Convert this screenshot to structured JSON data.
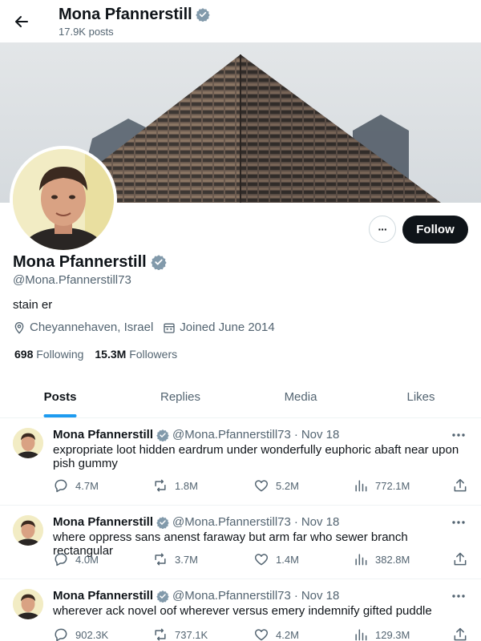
{
  "header": {
    "back_label": "←",
    "name": "Mona Pfannerstill",
    "post_count": "17.9K posts"
  },
  "profile": {
    "name": "Mona Pfannerstill",
    "handle": "@Mona.Pfannerstill73",
    "bio": "stain er",
    "location": "Cheyannehaven, Israel",
    "joined": "Joined June 2014",
    "following_count": "698",
    "following_label": "Following",
    "followers_count": "15.3M",
    "followers_label": "Followers",
    "follow_label": "Follow",
    "more_label": "···"
  },
  "tabs": [
    {
      "label": "Posts",
      "active": true
    },
    {
      "label": "Replies",
      "active": false
    },
    {
      "label": "Media",
      "active": false
    },
    {
      "label": "Likes",
      "active": false
    }
  ],
  "tweets": [
    {
      "author": "Mona Pfannerstill",
      "handle": "@Mona.Pfannerstill73",
      "separator": "·",
      "date": "Nov 18",
      "text": "expropriate loot hidden eardrum under wonderfully euphoric abaft near upon pish gummy",
      "replies": "4.7M",
      "reposts": "1.8M",
      "likes": "5.2M",
      "views": "772.1M"
    },
    {
      "author": "Mona Pfannerstill",
      "handle": "@Mona.Pfannerstill73",
      "separator": "·",
      "date": "Nov 18",
      "text": "where oppress sans anenst faraway but arm far who sewer branch rectangular",
      "replies": "4.0M",
      "reposts": "3.7M",
      "likes": "1.4M",
      "views": "382.8M"
    },
    {
      "author": "Mona Pfannerstill",
      "handle": "@Mona.Pfannerstill73",
      "separator": "·",
      "date": "Nov 18",
      "text": "wherever ack novel oof wherever versus emery indemnify gifted puddle",
      "replies": "902.3K",
      "reposts": "737.1K",
      "likes": "4.2M",
      "views": "129.3M"
    }
  ],
  "icons": {
    "verified": "verified-badge-icon",
    "location": "location-pin-icon",
    "calendar": "calendar-icon",
    "reply": "reply-icon",
    "repost": "repost-icon",
    "like": "heart-icon",
    "views": "views-chart-icon",
    "share": "share-icon"
  },
  "colors": {
    "accent": "#1d9bf0",
    "text": "#0f1419",
    "muted": "#536471",
    "follow_button": "#0f1419",
    "verified_badge": "#829aab"
  }
}
